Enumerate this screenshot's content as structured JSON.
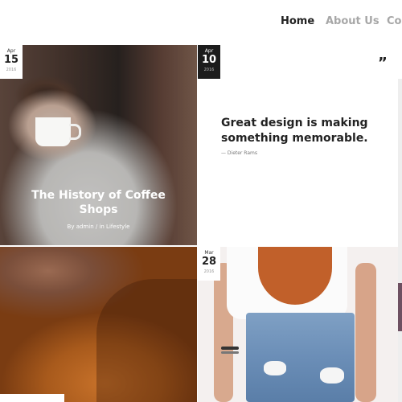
{
  "nav": {
    "items": [
      {
        "label": "Home",
        "active": true
      },
      {
        "label": "About Us",
        "active": false
      },
      {
        "label": "Co",
        "active": false
      }
    ]
  },
  "posts": [
    {
      "date": {
        "month": "Apr",
        "day": "15",
        "year": "2016"
      },
      "title": "The History of Coffee Shops",
      "meta": "By admin / in Lifestyle"
    },
    {
      "date": {
        "month": "Apr",
        "day": "10",
        "year": "2016"
      },
      "type": "quote",
      "quote_icon": "”",
      "quote": "Great design is making something memorable.",
      "author": "— Dieter Rams"
    },
    {
      "date": {
        "month": "Mar",
        "day": "28",
        "year": "2016"
      }
    }
  ],
  "colors": {
    "accent_active": "#222222",
    "nav_inactive": "#a7a7a7",
    "badge_dark": "#1c1c1c"
  }
}
